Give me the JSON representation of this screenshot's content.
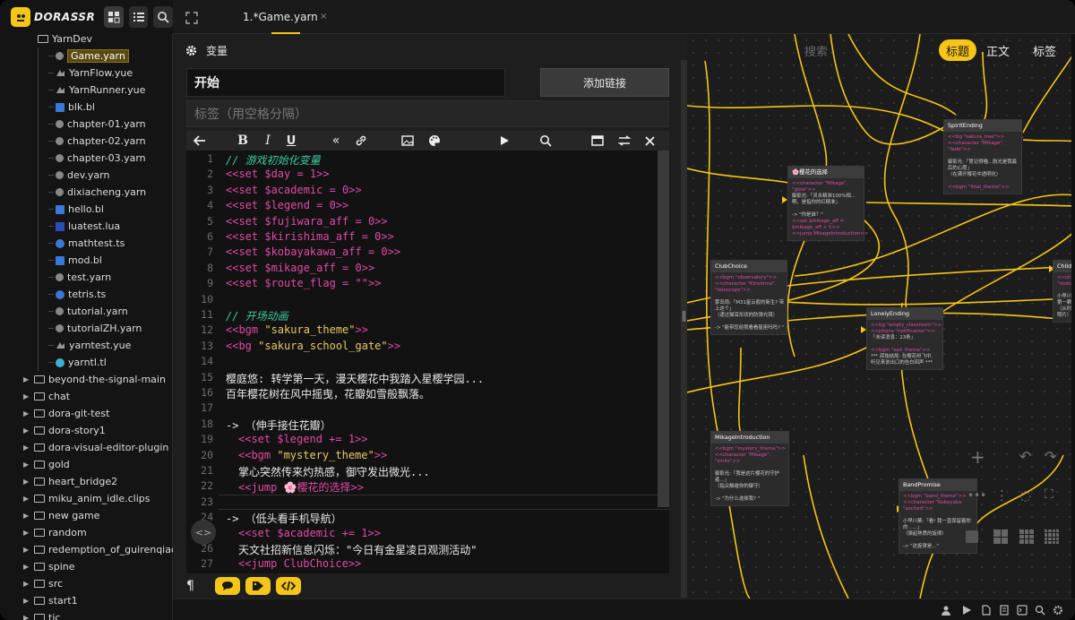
{
  "app": {
    "logo_text": "DORASSR"
  },
  "tab": {
    "label": "1.*Game.yarn",
    "close": "×"
  },
  "sidebar": {
    "tree": [
      {
        "label": "YarnDev",
        "type": "folder-open",
        "depth": 1
      },
      {
        "label": "Game.yarn",
        "type": "yarn",
        "depth": 2,
        "selected": true
      },
      {
        "label": "YarnFlow.yue",
        "type": "yue",
        "depth": 2
      },
      {
        "label": "YarnRunner.yue",
        "type": "yue",
        "depth": 2
      },
      {
        "label": "blk.bl",
        "type": "bl",
        "depth": 2
      },
      {
        "label": "chapter-01.yarn",
        "type": "yarn",
        "depth": 2
      },
      {
        "label": "chapter-02.yarn",
        "type": "yarn",
        "depth": 2
      },
      {
        "label": "chapter-03.yarn",
        "type": "yarn",
        "depth": 2
      },
      {
        "label": "dev.yarn",
        "type": "yarn",
        "depth": 2
      },
      {
        "label": "dixiacheng.yarn",
        "type": "yarn",
        "depth": 2
      },
      {
        "label": "hello.bl",
        "type": "bl",
        "depth": 2
      },
      {
        "label": "luatest.lua",
        "type": "lua",
        "depth": 2
      },
      {
        "label": "mathtest.ts",
        "type": "ts",
        "depth": 2
      },
      {
        "label": "mod.bl",
        "type": "bl",
        "depth": 2
      },
      {
        "label": "test.yarn",
        "type": "yarn",
        "depth": 2
      },
      {
        "label": "tetris.ts",
        "type": "ts",
        "depth": 2
      },
      {
        "label": "tutorial.yarn",
        "type": "yarn",
        "depth": 2
      },
      {
        "label": "tutorialZH.yarn",
        "type": "yarn",
        "depth": 2
      },
      {
        "label": "yarntest.yue",
        "type": "yue",
        "depth": 2
      },
      {
        "label": "yarntl.tl",
        "type": "tl",
        "depth": 2
      },
      {
        "label": "beyond-the-signal-main",
        "type": "folder",
        "depth": 0
      },
      {
        "label": "chat",
        "type": "folder",
        "depth": 0
      },
      {
        "label": "dora-git-test",
        "type": "folder",
        "depth": 0
      },
      {
        "label": "dora-story1",
        "type": "folder",
        "depth": 0
      },
      {
        "label": "dora-visual-editor-plugin",
        "type": "folder",
        "depth": 0
      },
      {
        "label": "gold",
        "type": "folder",
        "depth": 0
      },
      {
        "label": "heart_bridge2",
        "type": "folder",
        "depth": 0
      },
      {
        "label": "miku_anim_idle.clips",
        "type": "folder",
        "depth": 0
      },
      {
        "label": "new game",
        "type": "folder",
        "depth": 0
      },
      {
        "label": "random",
        "type": "folder",
        "depth": 0
      },
      {
        "label": "redemption_of_guirenqiao",
        "type": "folder",
        "depth": 0
      },
      {
        "label": "spine",
        "type": "folder",
        "depth": 0
      },
      {
        "label": "src",
        "type": "folder",
        "depth": 0
      },
      {
        "label": "start1",
        "type": "folder",
        "depth": 0
      },
      {
        "label": "tic",
        "type": "folder",
        "depth": 0
      }
    ]
  },
  "editor": {
    "variables_label": "变量",
    "title_value": "开始",
    "add_link_label": "添加链接",
    "tags_placeholder": "标签（用空格分隔）",
    "lines": [
      {
        "n": "1",
        "i": 0,
        "parts": [
          [
            "c",
            "// 游戏初始化变量"
          ]
        ]
      },
      {
        "n": "2",
        "i": 0,
        "parts": [
          [
            "m",
            "<<set $day = 1>>"
          ]
        ]
      },
      {
        "n": "3",
        "i": 0,
        "parts": [
          [
            "m",
            "<<set $academic = 0>>"
          ]
        ]
      },
      {
        "n": "4",
        "i": 0,
        "parts": [
          [
            "m",
            "<<set $legend = 0>>"
          ]
        ]
      },
      {
        "n": "5",
        "i": 0,
        "parts": [
          [
            "m",
            "<<set $fujiwara_aff = 0>>"
          ]
        ]
      },
      {
        "n": "6",
        "i": 0,
        "parts": [
          [
            "m",
            "<<set $kirishima_aff = 0>>"
          ]
        ]
      },
      {
        "n": "7",
        "i": 0,
        "parts": [
          [
            "m",
            "<<set $kobayakawa_aff = 0>>"
          ]
        ]
      },
      {
        "n": "8",
        "i": 0,
        "parts": [
          [
            "m",
            "<<set $mikage_aff = 0>>"
          ]
        ]
      },
      {
        "n": "9",
        "i": 0,
        "parts": [
          [
            "m",
            "<<set $route_flag = \"\">>"
          ]
        ]
      },
      {
        "n": "10",
        "i": 0,
        "parts": []
      },
      {
        "n": "11",
        "i": 0,
        "parts": [
          [
            "c",
            "// 开场动画"
          ]
        ]
      },
      {
        "n": "12",
        "i": 0,
        "parts": [
          [
            "m",
            "<<bgm "
          ],
          [
            "s",
            "\"sakura_theme\""
          ],
          [
            "m",
            ">>"
          ]
        ]
      },
      {
        "n": "13",
        "i": 0,
        "parts": [
          [
            "m",
            "<<bg "
          ],
          [
            "s",
            "\"sakura_school_gate\""
          ],
          [
            "m",
            ">>"
          ]
        ]
      },
      {
        "n": "14",
        "i": 0,
        "parts": []
      },
      {
        "n": "15",
        "i": 0,
        "parts": [
          [
            "t",
            "樱庭悠: 转学第一天，漫天樱花中我踏入星樱学园..."
          ]
        ]
      },
      {
        "n": "16",
        "i": 0,
        "parts": [
          [
            "t",
            "百年樱花树在风中摇曳，花瓣如雪般飘落。"
          ]
        ]
      },
      {
        "n": "17",
        "i": 0,
        "parts": []
      },
      {
        "n": "18",
        "i": 0,
        "parts": [
          [
            "t",
            "-> （伸手接住花瓣）"
          ]
        ]
      },
      {
        "n": "19",
        "i": 1,
        "parts": [
          [
            "m",
            "<<set $legend += 1>>"
          ]
        ]
      },
      {
        "n": "20",
        "i": 1,
        "parts": [
          [
            "m",
            "<<bgm "
          ],
          [
            "s",
            "\"mystery_theme\""
          ],
          [
            "m",
            ">>"
          ]
        ]
      },
      {
        "n": "21",
        "i": 1,
        "parts": [
          [
            "t",
            "掌心突然传来灼热感，御守发出微光..."
          ]
        ]
      },
      {
        "n": "22",
        "i": 1,
        "parts": [
          [
            "m",
            "<<jump 🌸樱花的选择>>"
          ]
        ]
      },
      {
        "n": "23",
        "i": 0,
        "parts": []
      },
      {
        "n": "24",
        "i": 0,
        "parts": [
          [
            "t",
            "-> （低头看手机导航）"
          ]
        ]
      },
      {
        "n": "25",
        "i": 1,
        "parts": [
          [
            "m",
            "<<set $academic += 1>>"
          ]
        ]
      },
      {
        "n": "26",
        "i": 1,
        "parts": [
          [
            "t",
            "天文社招新信息闪烁：\"今日有金星凌日观测活动\""
          ]
        ]
      },
      {
        "n": "27",
        "i": 1,
        "parts": [
          [
            "m",
            "<<jump ClubChoice>>"
          ]
        ]
      }
    ]
  },
  "graph": {
    "search_placeholder": "搜索",
    "modes": [
      {
        "label": "标题",
        "active": true
      },
      {
        "label": "正文",
        "active": false
      },
      {
        "label": "标签",
        "active": false
      }
    ],
    "nodes": [
      {
        "title": "SpiritEnding",
        "body": [
          [
            "m",
            "<<bg \"sakura_tree\">>"
          ],
          [
            "m",
            "<<character \"Mikage\","
          ],
          [
            "m",
            "\"fade\">>"
          ],
          [
            "t",
            ""
          ],
          [
            "t",
            "御影光:「誓记得喵...航光是我最"
          ],
          [
            "t",
            "后的心愿」"
          ],
          [
            "t",
            "（在满开樱花中透明化）"
          ],
          [
            "t",
            ""
          ],
          [
            "m",
            "<<bgm \"final_theme\">>"
          ]
        ]
      },
      {
        "title": "🌸樱花的选择",
        "body": [
          [
            "m",
            "<<character \"Mikage\","
          ],
          [
            "m",
            "\"glow\">>"
          ],
          [
            "t",
            "御影光:「灵永精准100%相..."
          ],
          [
            "t",
            "啊，是指你的红精准」"
          ],
          [
            "t",
            ""
          ],
          [
            "t",
            "-> \"你是谁？\""
          ],
          [
            "m",
            "<<set $mikage_aff ="
          ],
          [
            "m",
            "$mikage_aff + 5>>"
          ],
          [
            "m",
            "<<jump MikageIntroduction>>"
          ]
        ]
      },
      {
        "title": "ClubChoice",
        "body": [
          [
            "m",
            "<<bgm \"observatory\">>"
          ],
          [
            "m",
            "<<character \"Kirishima\","
          ],
          [
            "m",
            "\"telescope\">>"
          ],
          [
            "t",
            ""
          ],
          [
            "t",
            "雾岛雨:「M31星云般的新生? 带"
          ],
          [
            "t",
            "上这个」"
          ],
          [
            "t",
            "（递过猫耳形状的防弹光镜）"
          ],
          [
            "t",
            ""
          ],
          [
            "t",
            "-> \"能带您给我看看星座吗吗? \""
          ]
        ]
      },
      {
        "title": "LonelyEnding",
        "body": [
          [
            "m",
            "<<bg \"empty_classroom\">>"
          ],
          [
            "m",
            "<<phone \"notification\">>"
          ],
          [
            "t",
            "「未读消息：23条」"
          ],
          [
            "t",
            ""
          ],
          [
            "m",
            "<<bgm \"sad_theme\">>"
          ],
          [
            "t",
            "*** 孤独结局: 在樱花纷飞中,"
          ],
          [
            "t",
            "听见来说出口的告白回声 ***"
          ]
        ]
      },
      {
        "title": "ChildhoodFriend",
        "body": [
          [
            "m",
            "<<char"
          ],
          [
            "m",
            "\"nosta"
          ],
          [
            "t",
            ""
          ],
          [
            "t",
            "小早川类"
          ],
          [
            "t",
            "第一颗..."
          ],
          [
            "t",
            "（从时光"
          ],
          [
            "t",
            "照片）"
          ]
        ]
      },
      {
        "title": "MikageIntroduction",
        "body": [
          [
            "m",
            "<<bgm \"mystery_theme\">>"
          ],
          [
            "m",
            "<<character \"Mikage\","
          ],
          [
            "m",
            "\"smile\">>"
          ],
          [
            "t",
            ""
          ],
          [
            "t",
            "御影光:「我是这片樱花的守护"
          ],
          [
            "t",
            "者...」"
          ],
          [
            "t",
            "（指尖触碰你的御守）"
          ],
          [
            "t",
            ""
          ],
          [
            "t",
            "-> \"为什么选择我? \""
          ]
        ]
      },
      {
        "title": "BandPromise",
        "body": [
          [
            "m",
            "<<bgm \"band_theme\">>"
          ],
          [
            "m",
            "<<character \"Kobayaka"
          ],
          [
            "m",
            "\"excited\">>"
          ],
          [
            "t",
            ""
          ],
          [
            "t",
            "小早川葵:「看! 我一直保留着你"
          ],
          [
            "t",
            "的……」"
          ],
          [
            "t",
            "（弹起熟悉的旋律）"
          ],
          [
            "t",
            ""
          ],
          [
            "t",
            "-> \"这旋律是...\""
          ]
        ]
      }
    ]
  },
  "colors": {
    "accent": "#f5c518",
    "macro": "#e04aa6",
    "comment": "#3fc8a0",
    "string": "#e8c86a",
    "edge": "#f5c518"
  }
}
